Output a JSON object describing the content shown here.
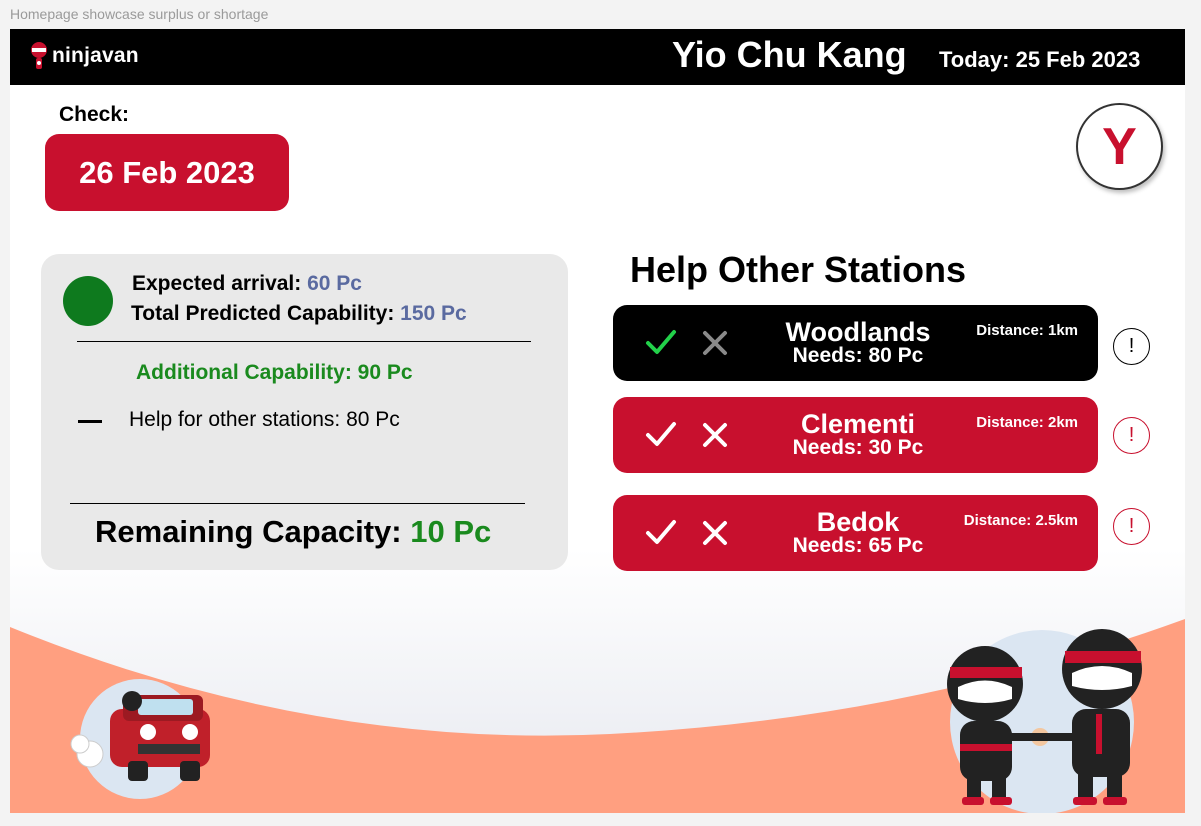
{
  "frame_label": "Homepage showcase surplus or shortage",
  "header": {
    "logo_text": "ninjavan",
    "station": "Yio Chu Kang",
    "today": "Today: 25 Feb 2023"
  },
  "check": {
    "label": "Check:",
    "date": "26 Feb 2023"
  },
  "avatar": {
    "initial": "Y"
  },
  "summary": {
    "expected_label": "Expected arrival: ",
    "expected_value": "60 Pc",
    "total_label": "Total Predicted Capability: ",
    "total_value": "150 Pc",
    "additional": "Additional Capability: 90 Pc",
    "help_other": "Help for other stations: 80 Pc",
    "remaining_label": "Remaining Capacity: ",
    "remaining_value": "10 Pc",
    "status_color": "#0e7a1e"
  },
  "help": {
    "title": "Help Other Stations",
    "stations": [
      {
        "name": "Woodlands",
        "needs": "Needs: 80 Pc",
        "distance": "Distance: 1km",
        "selected": true
      },
      {
        "name": "Clementi",
        "needs": "Needs: 30 Pc",
        "distance": "Distance: 2km",
        "selected": false
      },
      {
        "name": "Bedok",
        "needs": "Needs: 65 Pc",
        "distance": "Distance: 2.5km",
        "selected": false
      }
    ],
    "alert_symbol": "!"
  },
  "colors": {
    "brand_red": "#c8102e",
    "accepted_green": "#22d14a",
    "salmon": "#ff9f80"
  },
  "icons": {
    "check": "checkmark-icon",
    "cross": "cross-icon",
    "alert": "exclamation-circle-icon"
  }
}
